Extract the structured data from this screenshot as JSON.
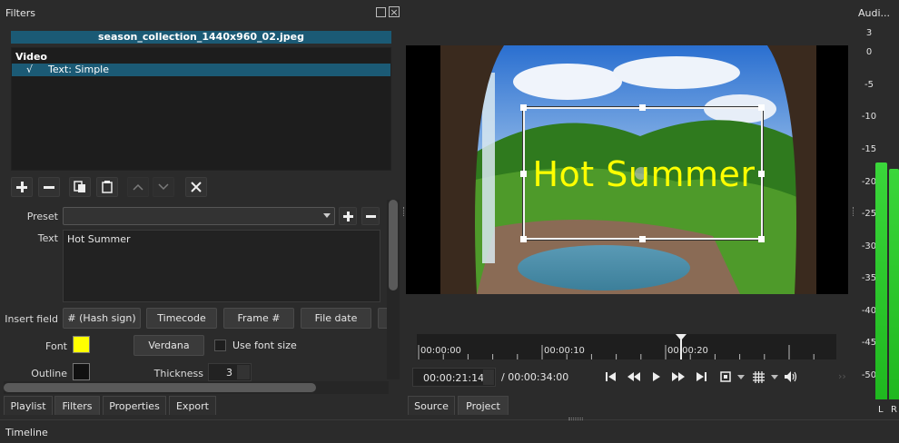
{
  "filters_panel": {
    "title": "Filters",
    "file_name": "season_collection_1440x960_02.jpeg",
    "category": "Video",
    "filter_item": {
      "check": "√",
      "label": "Text: Simple"
    },
    "preset_label": "Preset",
    "text_label": "Text",
    "text_value": "Hot Summer",
    "insert_field_label": "Insert field",
    "insert_buttons": [
      "# (Hash sign)",
      "Timecode",
      "Frame #",
      "File date"
    ],
    "font_label": "Font",
    "font_color": "#ffff00",
    "font_button": "Verdana",
    "use_font_size_label": "Use font size",
    "outline_label": "Outline",
    "outline_color": "#111111",
    "thickness_label": "Thickness",
    "thickness_value": "3"
  },
  "bottom_tabs": [
    "Playlist",
    "Filters",
    "Properties",
    "Export"
  ],
  "timeline_label": "Timeline",
  "player": {
    "overlay_text": "Hot Summer",
    "ruler_ticks": [
      "00:00:00",
      "00:00:10",
      "00:00:20"
    ],
    "playhead_fraction": 0.63,
    "current_time": "00:00:21:14",
    "total_time": "/ 00:00:34:00",
    "tabs": [
      "Source",
      "Project"
    ]
  },
  "audio_panel": {
    "title": "Audi...",
    "scale": [
      "3",
      "0",
      "-5",
      "-10",
      "-15",
      "-20",
      "-25",
      "-30",
      "-35",
      "-40",
      "-45",
      "-50"
    ],
    "scale_range": [
      3,
      -50
    ],
    "level_left_db": -17,
    "level_right_db": -18,
    "channel_left": "L",
    "channel_right": "R",
    "meter_color": "#1fb81f"
  }
}
